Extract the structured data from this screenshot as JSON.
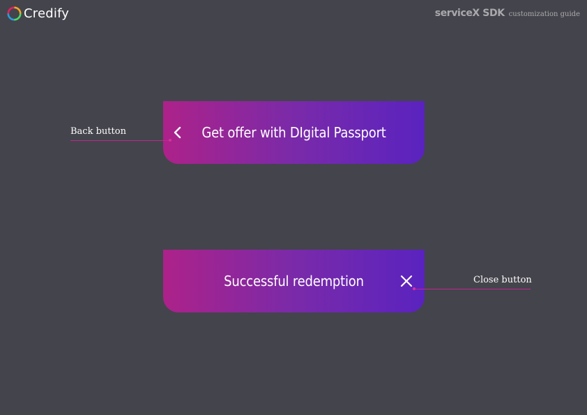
{
  "logo": {
    "text": "Credify"
  },
  "brand": {
    "title": "serviceX SDK",
    "subtitle": "customization guide"
  },
  "screens": [
    {
      "title": "Get offer with DIgital Passport",
      "nav_icon": "chevron-left-icon"
    },
    {
      "title": "Successful redemption",
      "nav_icon": "close-icon"
    }
  ],
  "callouts": {
    "back": "Back button",
    "close": "Close button"
  },
  "colors": {
    "background": "#44444c",
    "gradient_start": "#ad2289",
    "gradient_end": "#5a23bf",
    "callout_line": "#c2278f",
    "muted_text": "#a9a9ad"
  }
}
